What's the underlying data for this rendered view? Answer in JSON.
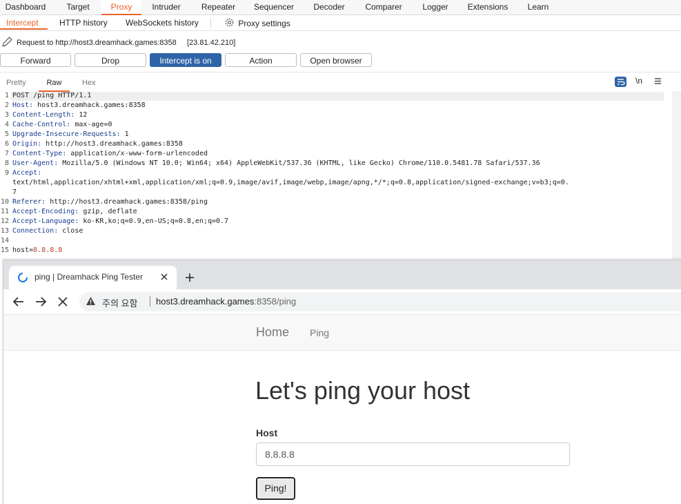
{
  "burp": {
    "top_tabs": [
      "Dashboard",
      "Target",
      "Proxy",
      "Intruder",
      "Repeater",
      "Sequencer",
      "Decoder",
      "Comparer",
      "Logger",
      "Extensions",
      "Learn"
    ],
    "sub_tabs": [
      "Intercept",
      "HTTP history",
      "WebSockets history"
    ],
    "proxy_settings_label": "Proxy settings",
    "request_label": "Request to http://host3.dreamhack.games:8358",
    "request_ip": "[23.81.42.210]",
    "buttons": {
      "forward": "Forward",
      "drop": "Drop",
      "intercept": "Intercept is on",
      "action": "Action",
      "open_browser": "Open browser"
    },
    "editor_tabs": [
      "Pretty",
      "Raw",
      "Hex"
    ],
    "newline_toggle": "\\n",
    "lines": [
      {
        "n": "1",
        "k": "",
        "v": "POST /ping HTTP/1.1"
      },
      {
        "n": "2",
        "k": "Host:",
        "v": " host3.dreamhack.games:8358"
      },
      {
        "n": "3",
        "k": "Content-Length:",
        "v": " 12"
      },
      {
        "n": "4",
        "k": "Cache-Control:",
        "v": " max-age=0"
      },
      {
        "n": "5",
        "k": "Upgrade-Insecure-Requests:",
        "v": " 1"
      },
      {
        "n": "6",
        "k": "Origin:",
        "v": " http://host3.dreamhack.games:8358"
      },
      {
        "n": "7",
        "k": "Content-Type:",
        "v": " application/x-www-form-urlencoded"
      },
      {
        "n": "8",
        "k": "User-Agent:",
        "v": " Mozilla/5.0 (Windows NT 10.0; Win64; x64) AppleWebKit/537.36 (KHTML, like Gecko) Chrome/110.0.5481.78 Safari/537.36"
      },
      {
        "n": "9",
        "k": "Accept:",
        "v": ""
      },
      {
        "n": "",
        "k": "",
        "v": "text/html,application/xhtml+xml,application/xml;q=0.9,image/avif,image/webp,image/apng,*/*;q=0.8,application/signed-exchange;v=b3;q=0."
      },
      {
        "n": "",
        "k": "",
        "v": "7"
      },
      {
        "n": "10",
        "k": "Referer:",
        "v": " http://host3.dreamhack.games:8358/ping"
      },
      {
        "n": "11",
        "k": "Accept-Encoding:",
        "v": " gzip, deflate"
      },
      {
        "n": "12",
        "k": "Accept-Language:",
        "v": " ko-KR,ko;q=0.9,en-US;q=0.8,en;q=0.7"
      },
      {
        "n": "13",
        "k": "Connection:",
        "v": " close"
      },
      {
        "n": "14",
        "k": "",
        "v": ""
      },
      {
        "n": "15",
        "k": "",
        "v": "host=",
        "p": "8.8.8.8"
      }
    ]
  },
  "browser": {
    "tab_title": "ping | Dreamhack Ping Tester",
    "security_label": "주의 요함",
    "url_host": "host3.dreamhack.games",
    "url_rest": ":8358/ping",
    "nav": {
      "home": "Home",
      "ping": "Ping"
    },
    "heading": "Let's ping your host",
    "host_label": "Host",
    "host_value": "8.8.8.8",
    "ping_button": "Ping!"
  },
  "colors": {
    "accent": "#e8622a",
    "primary_button": "#2f65a8",
    "header_key": "#1a3d8f",
    "param_value": "#c0392b"
  }
}
